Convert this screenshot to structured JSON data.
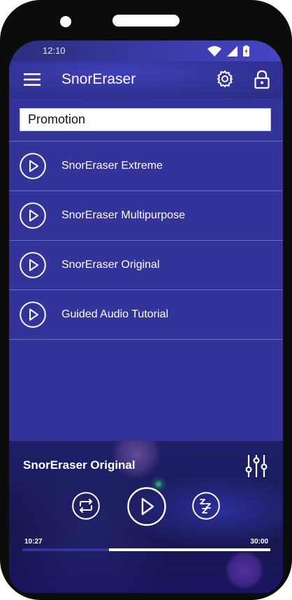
{
  "status_bar": {
    "time": "12:10"
  },
  "app_bar": {
    "title": "SnorEraser"
  },
  "promo": {
    "value": "Promotion"
  },
  "list": {
    "items": [
      {
        "label": "SnorEraser Extreme"
      },
      {
        "label": "SnorEraser Multipurpose"
      },
      {
        "label": "SnorEraser Original"
      },
      {
        "label": "Guided Audio Tutorial"
      }
    ]
  },
  "player": {
    "title": "SnorEraser Original",
    "elapsed": "10:27",
    "total": "30:00",
    "progress_fraction": 0.35
  },
  "icons": {
    "menu": "hamburger-menu-icon",
    "settings": "gear-icon",
    "lock": "lock-icon",
    "play": "play-icon",
    "repeat": "repeat-icon",
    "sleep": "sleep-zzz-icon",
    "equalizer": "equalizer-icon"
  },
  "colors": {
    "primary": "#33339a",
    "accent_white": "#ffffff",
    "progress_fill": "#35359f",
    "divider": "#6a6ac2"
  }
}
